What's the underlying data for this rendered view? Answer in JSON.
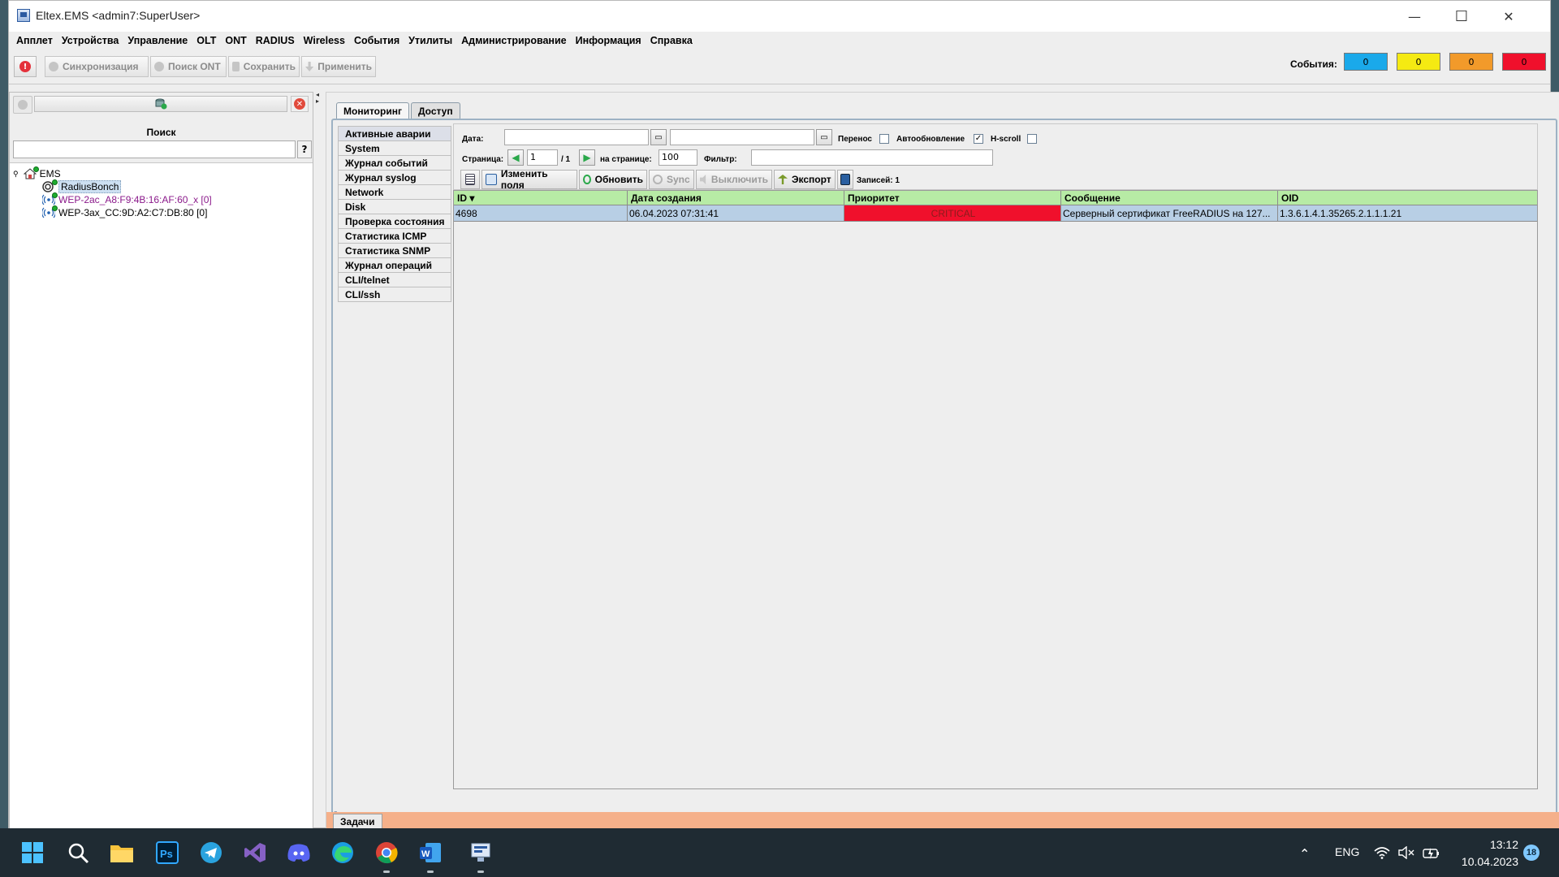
{
  "window": {
    "title": "Eltex.EMS <admin7:SuperUser>",
    "controls": [
      "—",
      "☐",
      "✕"
    ]
  },
  "menu": [
    "Апплет",
    "Устройства",
    "Управление",
    "OLT",
    "ONT",
    "RADIUS",
    "Wireless",
    "События",
    "Утилиты",
    "Администрирование",
    "Информация",
    "Справка"
  ],
  "toolbar": {
    "sync": "Синхронизация",
    "search_ont": "Поиск ONT",
    "save": "Сохранить",
    "apply": "Применить",
    "events_label": "События:",
    "event_counts": [
      {
        "value": "0",
        "color": "#1aa9ea"
      },
      {
        "value": "0",
        "color": "#f5ea12"
      },
      {
        "value": "0",
        "color": "#f29a2a"
      },
      {
        "value": "0",
        "color": "#f0102c"
      }
    ]
  },
  "left_panel": {
    "search_label": "Поиск",
    "search_value": "",
    "help_label": "?",
    "tree": [
      {
        "label": "EMS",
        "icon": "home-icon",
        "color": "#000000"
      },
      {
        "label": "RadiusBonch",
        "icon": "radius-server-icon",
        "color": "#000000",
        "selected": true
      },
      {
        "label": "WEP-2ac_A8:F9:4B:16:AF:60_x [0]",
        "icon": "access-point-icon",
        "color": "#8b1a8b"
      },
      {
        "label": "WEP-3ax_CC:9D:A2:C7:DB:80 [0]",
        "icon": "access-point-icon",
        "color": "#000000"
      }
    ]
  },
  "tabs": [
    {
      "label": "Мониторинг",
      "active": true
    },
    {
      "label": "Доступ",
      "active": false
    }
  ],
  "subnav": [
    {
      "label": "Активные аварии",
      "active": true
    },
    {
      "label": "System"
    },
    {
      "label": "Журнал событий"
    },
    {
      "label": "Журнал syslog"
    },
    {
      "label": "Network"
    },
    {
      "label": "Disk"
    },
    {
      "label": "Проверка состояния"
    },
    {
      "label": "Статистика ICMP"
    },
    {
      "label": "Статистика SNMP"
    },
    {
      "label": "Журнал операций"
    },
    {
      "label": "CLI/telnet"
    },
    {
      "label": "CLI/ssh"
    }
  ],
  "filters": {
    "date_label": "Дата:",
    "date_from": "",
    "date_to": "",
    "wrap_label": "Перенос",
    "wrap_checked": false,
    "autorefresh_label": "Автообновление",
    "autorefresh_checked": true,
    "hscroll_label": "H-scroll",
    "hscroll_checked": false,
    "page_label": "Страница:",
    "page_value": "1",
    "page_total": "/ 1",
    "per_page_label": "на странице:",
    "per_page_value": "100",
    "filter_label": "Фильтр:",
    "filter_value": "",
    "edit_fields": "Изменить поля",
    "refresh": "Обновить",
    "sync": "Sync",
    "disable": "Выключить",
    "export": "Экспорт",
    "records_label": "Записей: 1"
  },
  "table": {
    "columns": [
      "ID ▾",
      "Дата создания",
      "Приоритет",
      "Сообщение",
      "OID"
    ],
    "rows": [
      [
        "4698",
        "06.04.2023 07:31:41",
        "CRITICAL",
        "Серверный сертификат FreeRADIUS на 127...",
        "1.3.6.1.4.1.35265.2.1.1.1.21"
      ]
    ]
  },
  "tasks_label": "Задачи",
  "taskbar": {
    "apps": [
      "windows-start-icon",
      "search-icon",
      "file-explorer-icon",
      "photoshop-icon",
      "telegram-icon",
      "visual-studio-icon",
      "discord-icon",
      "edge-icon",
      "chrome-icon",
      "word-icon",
      "eltex-ems-icon"
    ],
    "lang": "ENG",
    "time": "13:12",
    "date": "10.04.2023",
    "notifications": "18"
  }
}
